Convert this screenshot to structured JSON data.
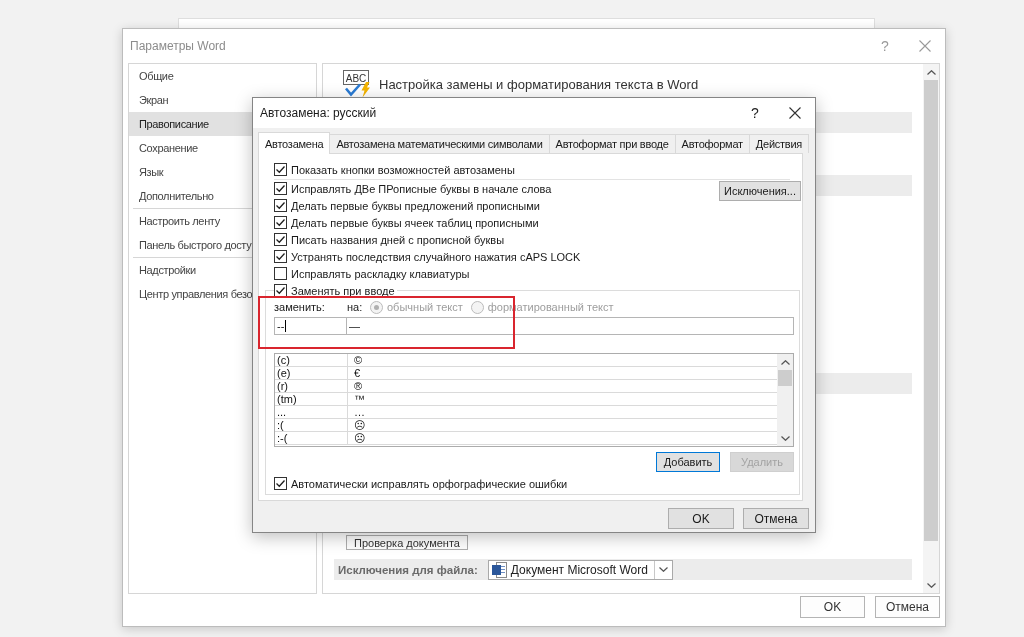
{
  "word_options": {
    "title": "Параметры Word",
    "help": "?",
    "sidebar": {
      "groups": [
        [
          {
            "label": "Общие",
            "selected": false
          },
          {
            "label": "Экран",
            "selected": false
          },
          {
            "label": "Правописание",
            "selected": true
          },
          {
            "label": "Сохранение",
            "selected": false
          },
          {
            "label": "Язык",
            "selected": false
          },
          {
            "label": "Дополнительно",
            "selected": false
          }
        ],
        [
          {
            "label": "Настроить ленту",
            "selected": false
          },
          {
            "label": "Панель быстрого досту",
            "selected": false
          }
        ],
        [
          {
            "label": "Надстройки",
            "selected": false
          },
          {
            "label": "Центр управления безо",
            "selected": false
          }
        ]
      ]
    },
    "header": {
      "icon_text": "ABC",
      "title": "Настройка замены и форматирования текста в Word"
    },
    "proofing_button": "Проверка документа",
    "file_exceptions": {
      "label": "Исключения для файла:",
      "value": "Документ Microsoft Word"
    },
    "buttons": [
      "OK",
      "Отмена"
    ]
  },
  "autocorrect": {
    "title": "Автозамена: русский",
    "help": "?",
    "tabs": [
      {
        "label": "Автозамена",
        "selected": true
      },
      {
        "label": "Автозамена математическими символами",
        "selected": false
      },
      {
        "label": "Автоформат при вводе",
        "selected": false
      },
      {
        "label": "Автоформат",
        "selected": false
      },
      {
        "label": "Действия",
        "selected": false
      }
    ],
    "show_buttons": {
      "label": "Показать кнопки возможностей автозамены",
      "checked": true
    },
    "options": [
      {
        "label": "Исправлять ДВе ПРописные буквы в начале слова",
        "checked": true
      },
      {
        "label": "Делать первые буквы предложений прописными",
        "checked": true
      },
      {
        "label": "Делать первые буквы ячеек таблиц прописными",
        "checked": true
      },
      {
        "label": "Писать названия дней с прописной буквы",
        "checked": true
      },
      {
        "label": "Устранять последствия случайного нажатия cAPS LOCK",
        "checked": true
      },
      {
        "label": "Исправлять раскладку клавиатуры",
        "checked": false
      }
    ],
    "exceptions_button": "Исключения...",
    "replace_group": {
      "label": "Заменять при вводе",
      "checked": true,
      "replace_label": "заменить:",
      "with_label": "на:",
      "radios": [
        {
          "label": "обычный текст",
          "selected": true,
          "disabled": true
        },
        {
          "label": "форматированный текст",
          "selected": false,
          "disabled": true
        }
      ],
      "replace_value": "--",
      "replace_focused": true,
      "with_value": "—",
      "entries": [
        {
          "replace": "(c)",
          "with": "©"
        },
        {
          "replace": "(e)",
          "with": "€"
        },
        {
          "replace": "(r)",
          "with": "®"
        },
        {
          "replace": "(tm)",
          "with": "™"
        },
        {
          "replace": "...",
          "with": "…"
        },
        {
          "replace": ":(",
          "with": "☹"
        },
        {
          "replace": ":-(",
          "with": "☹"
        }
      ],
      "buttons": [
        {
          "label": "Добавить",
          "default": true,
          "disabled": false
        },
        {
          "label": "Удалить",
          "default": false,
          "disabled": true
        }
      ]
    },
    "spelling": {
      "label": "Автоматически исправлять орфографические ошибки",
      "checked": true
    },
    "buttons": [
      "OK",
      "Отмена"
    ]
  }
}
